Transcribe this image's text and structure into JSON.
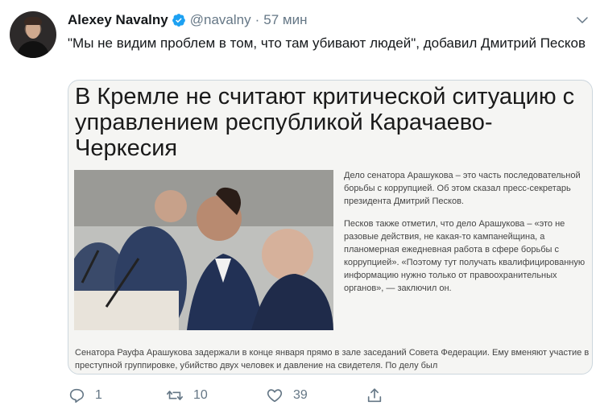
{
  "tweet": {
    "author_name": "Alexey Navalny",
    "handle": "@navalny",
    "separator": "·",
    "time": "57 мин",
    "text": "\"Мы не видим проблем в том, что там убивают людей\", добавил Дмитрий Песков"
  },
  "card": {
    "title": "В Кремле не считают критической ситуацию с управлением республикой Карачаево-Черкесия",
    "side_paragraph_1": "Дело сенатора Арашукова – это часть последовательной борьбы с коррупцией. Об этом сказал пресс-секретарь президента Дмитрий Песков.",
    "side_paragraph_2": "Песков также отметил, что дело Арашукова – «это не разовые действия, не какая-то кампанейщина, а планомерная ежедневная работа в сфере борьбы с коррупцией». «Поэтому тут получать квалифицированную информацию нужно только от правоохранительных органов», — заключил он.",
    "bottom_text": "Сенатора Рауфа Арашукова задержали в конце января прямо в зале заседаний Совета Федерации. Ему вменяют участие в преступной группировке, убийство двух человек и давление на свидетеля. По делу был"
  },
  "actions": {
    "reply_count": "1",
    "retweet_count": "10",
    "like_count": "39"
  },
  "colors": {
    "text_primary": "#14171a",
    "text_secondary": "#657786",
    "verified_blue": "#1da1f2",
    "card_border": "#ccd6dd"
  },
  "icons": [
    "verified-badge-icon",
    "chevron-down-icon",
    "reply-icon",
    "retweet-icon",
    "like-icon",
    "share-icon"
  ]
}
